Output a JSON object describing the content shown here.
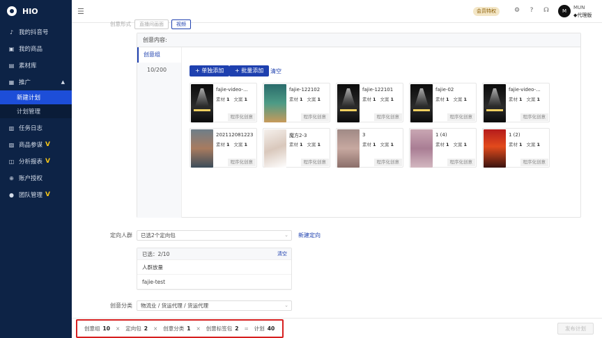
{
  "brand": {
    "name": "HIO"
  },
  "sidebar": {
    "items": [
      {
        "label": "我的抖音号",
        "icon": "tiktok-icon"
      },
      {
        "label": "我的商品",
        "icon": "shop-icon"
      },
      {
        "label": "素材库",
        "icon": "folder-icon"
      },
      {
        "label": "推广",
        "icon": "promotion-icon"
      },
      {
        "label": "任务日志",
        "icon": "log-icon"
      },
      {
        "label": "商品参谋",
        "icon": "bag-icon",
        "vip": "V"
      },
      {
        "label": "分析报表",
        "icon": "report-icon",
        "vip": "V"
      },
      {
        "label": "账户授权",
        "icon": "link-icon"
      },
      {
        "label": "团队管理",
        "icon": "team-icon",
        "vip": "V"
      }
    ],
    "sub_items": [
      {
        "label": "新建计划",
        "active": true
      },
      {
        "label": "计划管理",
        "active": false
      }
    ]
  },
  "header": {
    "member_badge": "会员特权",
    "user_name": "MUN",
    "agent_tag": "代理版",
    "avatar_text": "M"
  },
  "main": {
    "label_peek": "创意形式",
    "tab_peek": [
      "直播间画面",
      "视频"
    ],
    "content_title": "创意内容:",
    "group_label": "创意组",
    "group_count": "10/200",
    "add_single": "+ 单独添加",
    "add_batch": "+ 批量添加",
    "clear": "清空",
    "cards": [
      {
        "title": "fajie-video-...",
        "material_label": "素材",
        "material": "1",
        "copy_label": "文案",
        "copy": "1",
        "tag": "程序化创意",
        "thumb": "dark"
      },
      {
        "title": "fajie-122102",
        "material_label": "素材",
        "material": "1",
        "copy_label": "文案",
        "copy": "1",
        "tag": "程序化创意",
        "thumb": "teal"
      },
      {
        "title": "fajie-122101",
        "material_label": "素材",
        "material": "1",
        "copy_label": "文案",
        "copy": "1",
        "tag": "程序化创意",
        "thumb": "dark"
      },
      {
        "title": "fajie-02",
        "material_label": "素材",
        "material": "1",
        "copy_label": "文案",
        "copy": "1",
        "tag": "程序化创意",
        "thumb": "dark"
      },
      {
        "title": "fajie-video-...",
        "material_label": "素材",
        "material": "1",
        "copy_label": "文案",
        "copy": "1",
        "tag": "程序化创意",
        "thumb": "dark"
      },
      {
        "title": "202112081223",
        "material_label": "素材",
        "material": "1",
        "copy_label": "文案",
        "copy": "1",
        "tag": "程序化创意",
        "thumb": "room"
      },
      {
        "title": "魔方2-3",
        "material_label": "素材",
        "material": "1",
        "copy_label": "文案",
        "copy": "1",
        "tag": "程序化创意",
        "thumb": "white"
      },
      {
        "title": "3",
        "material_label": "素材",
        "material": "1",
        "copy_label": "文案",
        "copy": "1",
        "tag": "程序化创意",
        "thumb": "blur1"
      },
      {
        "title": "1 (4)",
        "material_label": "素材",
        "material": "1",
        "copy_label": "文案",
        "copy": "1",
        "tag": "程序化创意",
        "thumb": "blur2"
      },
      {
        "title": "1 (2)",
        "material_label": "素材",
        "material": "1",
        "copy_label": "文案",
        "copy": "1",
        "tag": "程序化创意",
        "thumb": "red"
      }
    ],
    "targeting": {
      "label": "定向人群",
      "select_value": "已选2个定向包",
      "new_link": "新建定向",
      "selected_header": "已选：2/10",
      "selected_clear": "清空",
      "selected_items": [
        "人群放量",
        "fajie-test"
      ]
    },
    "category": {
      "label": "创意分类",
      "select_value": "物流业 / 货运代理 / 货运代理"
    }
  },
  "bottom": {
    "summary": [
      {
        "label": "创意组",
        "value": "10",
        "op": "×"
      },
      {
        "label": "定向包",
        "value": "2",
        "op": "×"
      },
      {
        "label": "创意分类",
        "value": "1",
        "op": "×"
      },
      {
        "label": "创意标签包",
        "value": "2",
        "op": "="
      },
      {
        "label": "计划",
        "value": "40",
        "op": ""
      }
    ],
    "publish": "发布计划"
  },
  "colors": {
    "sidebar": "#0d2346",
    "accent": "#1e40af",
    "highlight": "#d61f1f"
  }
}
